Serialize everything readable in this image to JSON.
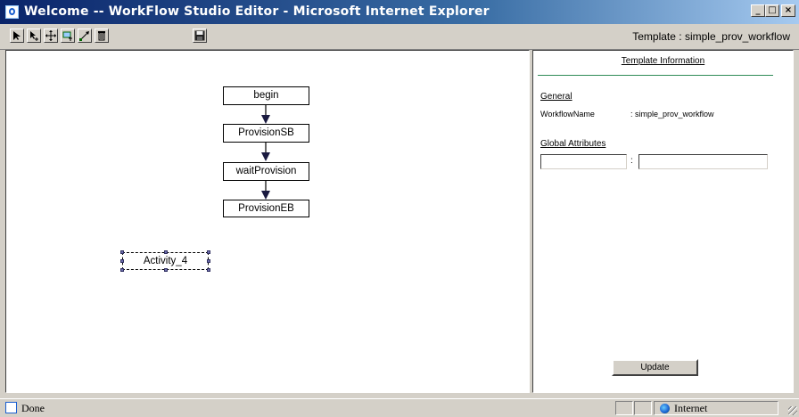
{
  "window": {
    "title": "Welcome -- WorkFlow Studio Editor - Microsoft Internet Explorer",
    "minimize": "_",
    "maximize": "□",
    "close": "×"
  },
  "toolbar": {
    "tools": [
      "select-tool",
      "pointer-tool",
      "move-tool",
      "add-activity-tool",
      "connect-tool",
      "delete-tool"
    ],
    "save": "save-icon",
    "template_label": "Template : simple_prov_workflow"
  },
  "canvas": {
    "nodes": [
      "begin",
      "ProvisionSB",
      "waitProvision",
      "ProvisionEB"
    ],
    "selected_activity": "Activity_4"
  },
  "panel": {
    "heading": "Template Information",
    "general_heading": "General",
    "workflow_name_label": "WorkflowName",
    "workflow_name_value": ": simple_prov_workflow",
    "global_attributes_heading": "Global Attributes",
    "attr_key": "",
    "attr_separator": ":",
    "attr_value": "",
    "update_label": "Update"
  },
  "statusbar": {
    "status": "Done",
    "zone": "Internet"
  }
}
